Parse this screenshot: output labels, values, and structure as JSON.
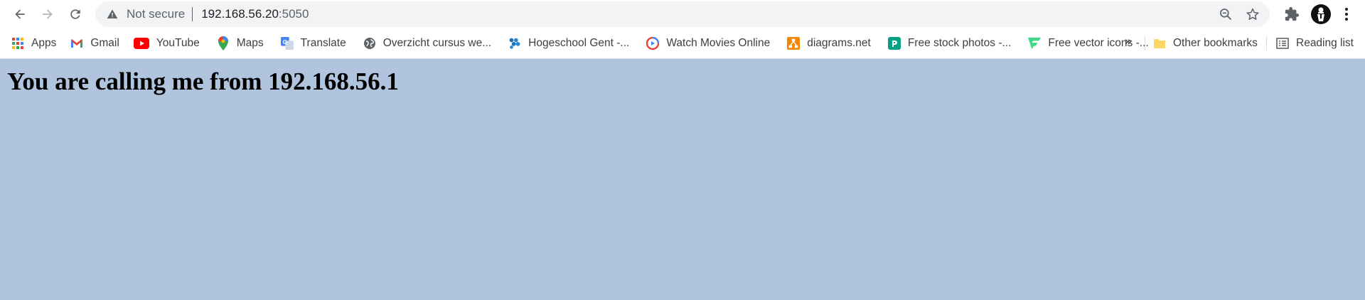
{
  "address_bar": {
    "security_label": "Not secure",
    "host": "192.168.56.20",
    "port": ":5050"
  },
  "bookmarks": [
    {
      "label": "Apps",
      "icon": "apps-grid-icon"
    },
    {
      "label": "Gmail",
      "icon": "gmail-icon"
    },
    {
      "label": "YouTube",
      "icon": "youtube-icon"
    },
    {
      "label": "Maps",
      "icon": "maps-icon"
    },
    {
      "label": "Translate",
      "icon": "translate-icon"
    },
    {
      "label": "Overzicht cursus we...",
      "icon": "globe-icon"
    },
    {
      "label": "Hogeschool Gent -...",
      "icon": "hogent-icon"
    },
    {
      "label": "Watch Movies Online",
      "icon": "movies-icon"
    },
    {
      "label": "diagrams.net",
      "icon": "diagrams-icon"
    },
    {
      "label": "Free stock photos -...",
      "icon": "stock-photos-icon"
    },
    {
      "label": "Free vector icons -...",
      "icon": "vector-icons-icon"
    }
  ],
  "bookmarks_overflow": "»",
  "other_bookmarks": "Other bookmarks",
  "reading_list": "Reading list",
  "page": {
    "heading": "You are calling me from 192.168.56.1"
  },
  "colors": {
    "page_background": "#b0c4de",
    "omnibox_background": "#f1f3f4"
  }
}
